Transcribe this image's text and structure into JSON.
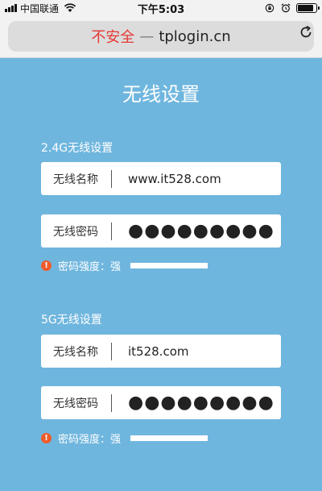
{
  "status_bar": {
    "carrier": "中国联通",
    "time": "下午5:03",
    "icons": [
      "signal-icon",
      "wifi-icon",
      "orientation-lock-icon",
      "alarm-icon",
      "battery-icon"
    ]
  },
  "browser": {
    "security_label": "不安全",
    "separator": "—",
    "domain": "tplogin.cn",
    "reload_icon": "reload-icon"
  },
  "page": {
    "title": "无线设置",
    "colors": {
      "background": "#6fb6de",
      "warning": "#ef5b2b",
      "insecure": "#e53935"
    },
    "band_24": {
      "label": "2.4G无线设置",
      "name_label": "无线名称",
      "name_value": "www.it528.com",
      "password_label": "无线密码",
      "password_value": "●●●●●●●●●",
      "strength_label": "密码强度：",
      "strength_value": "强",
      "warning_icon": "!"
    },
    "band_5": {
      "label": "5G无线设置",
      "name_label": "无线名称",
      "name_value": "it528.com",
      "password_label": "无线密码",
      "password_value": "●●●●●●●●●",
      "strength_label": "密码强度：",
      "strength_value": "强",
      "warning_icon": "!"
    }
  }
}
